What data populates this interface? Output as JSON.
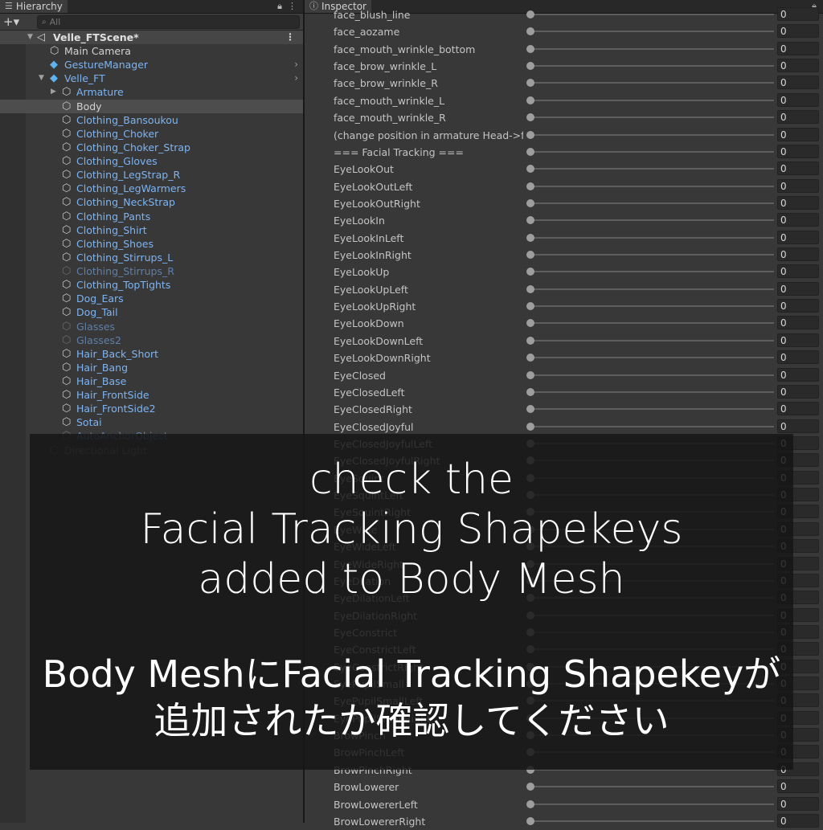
{
  "hierarchy": {
    "tab_label": "Hierarchy",
    "tab_icon": "list-icon",
    "add_label": "+▾",
    "search_placeholder": "All",
    "scene_name": "Velle_FTScene*",
    "items": [
      {
        "label": "Main Camera",
        "depth": 1,
        "icon": "cube-icon",
        "icon_style": "white",
        "text_style": "norm"
      },
      {
        "label": "GestureManager",
        "depth": 1,
        "icon": "prefab-icon",
        "icon_style": "blue",
        "text_style": "blue",
        "chevron": true
      },
      {
        "label": "Velle_FT",
        "depth": 1,
        "icon": "prefab-model-icon",
        "icon_style": "blue",
        "text_style": "blue",
        "expanded": true,
        "chevron": true
      },
      {
        "label": "Armature",
        "depth": 2,
        "icon": "cube-icon",
        "icon_style": "white",
        "text_style": "blue",
        "collapsed": true
      },
      {
        "label": "Body",
        "depth": 2,
        "icon": "cube-icon",
        "icon_style": "white",
        "text_style": "norm",
        "selected": true
      },
      {
        "label": "Clothing_Bansoukou",
        "depth": 2,
        "icon": "cube-icon",
        "icon_style": "white",
        "text_style": "blue"
      },
      {
        "label": "Clothing_Choker",
        "depth": 2,
        "icon": "cube-icon",
        "icon_style": "white",
        "text_style": "blue"
      },
      {
        "label": "Clothing_Choker_Strap",
        "depth": 2,
        "icon": "cube-icon",
        "icon_style": "white",
        "text_style": "blue"
      },
      {
        "label": "Clothing_Gloves",
        "depth": 2,
        "icon": "cube-icon",
        "icon_style": "white",
        "text_style": "blue"
      },
      {
        "label": "Clothing_LegStrap_R",
        "depth": 2,
        "icon": "cube-icon",
        "icon_style": "white",
        "text_style": "blue"
      },
      {
        "label": "Clothing_LegWarmers",
        "depth": 2,
        "icon": "cube-icon",
        "icon_style": "white",
        "text_style": "blue"
      },
      {
        "label": "Clothing_NeckStrap",
        "depth": 2,
        "icon": "cube-icon",
        "icon_style": "white",
        "text_style": "blue"
      },
      {
        "label": "Clothing_Pants",
        "depth": 2,
        "icon": "cube-icon",
        "icon_style": "white",
        "text_style": "blue"
      },
      {
        "label": "Clothing_Shirt",
        "depth": 2,
        "icon": "cube-icon",
        "icon_style": "white",
        "text_style": "blue"
      },
      {
        "label": "Clothing_Shoes",
        "depth": 2,
        "icon": "cube-icon",
        "icon_style": "white",
        "text_style": "blue"
      },
      {
        "label": "Clothing_Stirrups_L",
        "depth": 2,
        "icon": "cube-icon",
        "icon_style": "white",
        "text_style": "blue"
      },
      {
        "label": "Clothing_Stirrups_R",
        "depth": 2,
        "icon": "cube-icon",
        "icon_style": "dim",
        "text_style": "dim"
      },
      {
        "label": "Clothing_TopTights",
        "depth": 2,
        "icon": "cube-icon",
        "icon_style": "white",
        "text_style": "blue"
      },
      {
        "label": "Dog_Ears",
        "depth": 2,
        "icon": "cube-icon",
        "icon_style": "white",
        "text_style": "blue"
      },
      {
        "label": "Dog_Tail",
        "depth": 2,
        "icon": "cube-icon",
        "icon_style": "white",
        "text_style": "blue"
      },
      {
        "label": "Glasses",
        "depth": 2,
        "icon": "cube-icon",
        "icon_style": "dim",
        "text_style": "dim"
      },
      {
        "label": "Glasses2",
        "depth": 2,
        "icon": "cube-icon",
        "icon_style": "dim",
        "text_style": "dim"
      },
      {
        "label": "Hair_Back_Short",
        "depth": 2,
        "icon": "cube-icon",
        "icon_style": "white",
        "text_style": "blue"
      },
      {
        "label": "Hair_Bang",
        "depth": 2,
        "icon": "cube-icon",
        "icon_style": "white",
        "text_style": "blue"
      },
      {
        "label": "Hair_Base",
        "depth": 2,
        "icon": "cube-icon",
        "icon_style": "white",
        "text_style": "blue"
      },
      {
        "label": "Hair_FrontSide",
        "depth": 2,
        "icon": "cube-icon",
        "icon_style": "white",
        "text_style": "blue"
      },
      {
        "label": "Hair_FrontSide2",
        "depth": 2,
        "icon": "cube-icon",
        "icon_style": "white",
        "text_style": "blue"
      },
      {
        "label": "Sotai",
        "depth": 2,
        "icon": "cube-icon",
        "icon_style": "white",
        "text_style": "blue"
      },
      {
        "label": "AutoAnchorObject",
        "depth": 2,
        "icon": "cube-icon",
        "icon_style": "dim",
        "text_style": "dim"
      },
      {
        "label": "Directional Light",
        "depth": 1,
        "icon": "cube-icon",
        "icon_style": "dim",
        "text_style": "dimg"
      }
    ]
  },
  "inspector": {
    "tab_label": "Inspector",
    "tab_icon": "info-icon",
    "blendshapes": [
      {
        "name": "face_blush_line",
        "value": "0"
      },
      {
        "name": "face_aozame",
        "value": "0"
      },
      {
        "name": "face_mouth_wrinkle_bottom",
        "value": "0"
      },
      {
        "name": "face_brow_wrinkle_L",
        "value": "0"
      },
      {
        "name": "face_brow_wrinkle_R",
        "value": "0"
      },
      {
        "name": "face_mouth_wrinkle_L",
        "value": "0"
      },
      {
        "name": "face_mouth_wrinkle_R",
        "value": "0"
      },
      {
        "name": "(change position in armature Head->face)",
        "value": "0"
      },
      {
        "name": "=== Facial Tracking ===",
        "value": "0"
      },
      {
        "name": "EyeLookOut",
        "value": "0"
      },
      {
        "name": "EyeLookOutLeft",
        "value": "0"
      },
      {
        "name": "EyeLookOutRight",
        "value": "0"
      },
      {
        "name": "EyeLookIn",
        "value": "0"
      },
      {
        "name": "EyeLookInLeft",
        "value": "0"
      },
      {
        "name": "EyeLookInRight",
        "value": "0"
      },
      {
        "name": "EyeLookUp",
        "value": "0"
      },
      {
        "name": "EyeLookUpLeft",
        "value": "0"
      },
      {
        "name": "EyeLookUpRight",
        "value": "0"
      },
      {
        "name": "EyeLookDown",
        "value": "0"
      },
      {
        "name": "EyeLookDownLeft",
        "value": "0"
      },
      {
        "name": "EyeLookDownRight",
        "value": "0"
      },
      {
        "name": "EyeClosed",
        "value": "0"
      },
      {
        "name": "EyeClosedLeft",
        "value": "0"
      },
      {
        "name": "EyeClosedRight",
        "value": "0"
      },
      {
        "name": "EyeClosedJoyful",
        "value": "0"
      },
      {
        "name": "EyeClosedJoyfulLeft",
        "value": "0"
      },
      {
        "name": "EyeClosedJoyfulRight",
        "value": "0"
      },
      {
        "name": "EyeSquint",
        "value": "0"
      },
      {
        "name": "EyeSquintLeft",
        "value": "0"
      },
      {
        "name": "EyeSquintRight",
        "value": "0"
      },
      {
        "name": "EyeWide",
        "value": "0"
      },
      {
        "name": "EyeWideLeft",
        "value": "0"
      },
      {
        "name": "EyeWideRight",
        "value": "0"
      },
      {
        "name": "EyeDilation",
        "value": "0"
      },
      {
        "name": "EyeDilationLeft",
        "value": "0"
      },
      {
        "name": "EyeDilationRight",
        "value": "0"
      },
      {
        "name": "EyeConstrict",
        "value": "0"
      },
      {
        "name": "EyeConstrictLeft",
        "value": "0"
      },
      {
        "name": "EyeConstrictRight",
        "value": "0"
      },
      {
        "name": "EyePupilSmall",
        "value": "0"
      },
      {
        "name": "EyePupilSmallLeft",
        "value": "0"
      },
      {
        "name": "EyePupilSmallRight",
        "value": "0"
      },
      {
        "name": "BrowPinch",
        "value": "0"
      },
      {
        "name": "BrowPinchLeft",
        "value": "0"
      },
      {
        "name": "BrowPinchRight",
        "value": "0"
      },
      {
        "name": "BrowLowerer",
        "value": "0"
      },
      {
        "name": "BrowLowererLeft",
        "value": "0"
      },
      {
        "name": "BrowLowererRight",
        "value": "0"
      }
    ]
  },
  "overlay": {
    "en_line1": "check the",
    "en_line2": "Facial Tracking Shapekeys",
    "en_line3": "added to Body Mesh",
    "jp_line1": "Body MeshにFacial Tracking Shapekeyが",
    "jp_line2": "追加されたか確認してください"
  },
  "colors": {
    "background": "#383838",
    "selected_row": "#4d4d4d",
    "prefab_text": "#7cb4f3",
    "overlay_bg": "#161616"
  }
}
